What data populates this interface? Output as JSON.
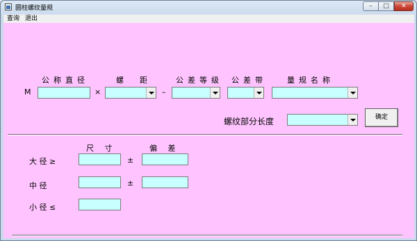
{
  "window": {
    "title": "圆柱螺纹量规"
  },
  "window_controls": {
    "minimize": "–",
    "maximize": "□",
    "close": "✕"
  },
  "menu": {
    "items": [
      "查询",
      "退出"
    ]
  },
  "form": {
    "prefix": "M",
    "headers": {
      "nominal_diameter": "公称直径",
      "pitch": "螺　距",
      "tolerance_grade": "公差等级",
      "tolerance_zone": "公差带",
      "gauge_name": "量规名称"
    },
    "times_symbol": "×",
    "dash_symbol": "–",
    "thread_length_label": "螺纹部分长度",
    "confirm_button": "确定"
  },
  "results": {
    "size_header": "尺 寸",
    "deviation_header": "偏 差",
    "major_diameter_label": "大 径 ≥",
    "pitch_diameter_label": "中 径",
    "minor_diameter_label": "小 径 ≤",
    "plus_minus": "±"
  }
}
